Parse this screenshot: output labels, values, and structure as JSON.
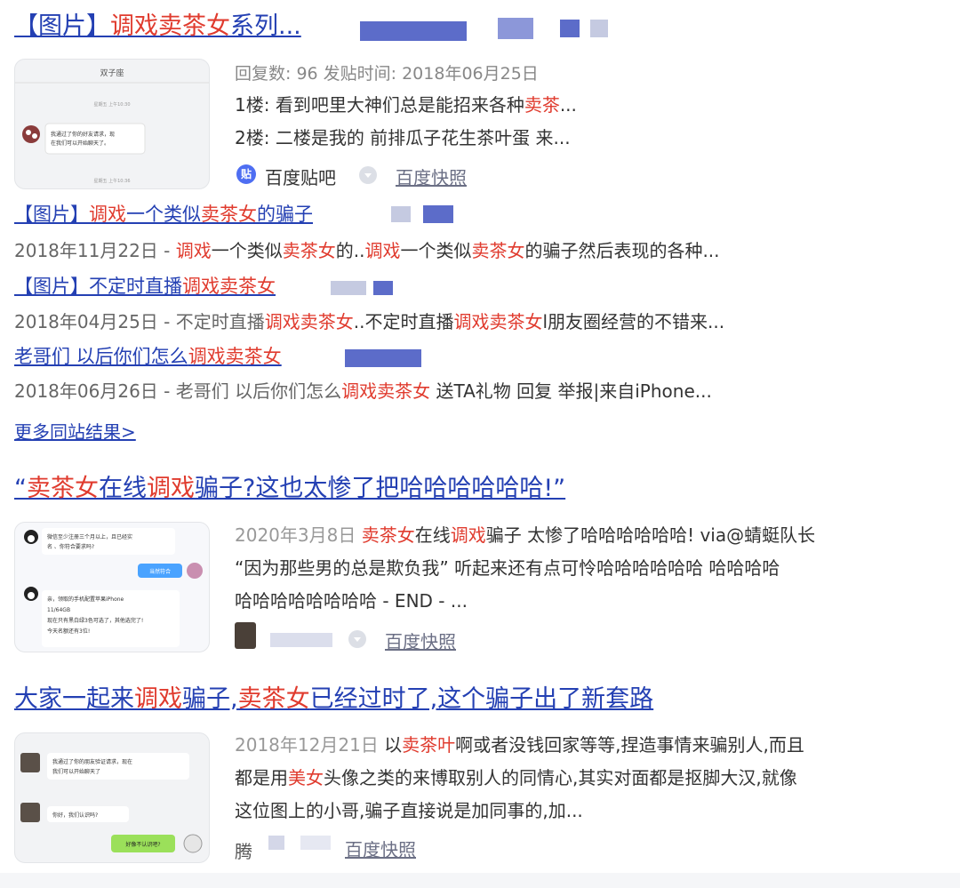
{
  "result1": {
    "title_parts": [
      "【图片】",
      "调戏卖茶女",
      "系列..."
    ],
    "thumb": {
      "header": "双子座",
      "time_top": "星期五 上午10:30",
      "bubble": "我通过了你的好友请求，现在我们可以开始聊天了。",
      "time_bottom": "星期五 上午10:36"
    },
    "meta": "回复数: 96 发贴时间: 2018年06月25日",
    "floors": [
      {
        "prefix": "1楼: 看到吧里大神们总是能招来各种",
        "hl": "卖茶",
        "suffix": "..."
      },
      {
        "prefix": "2楼: 二楼是我的 前排瓜子花生茶叶蛋 来...",
        "hl": "",
        "suffix": ""
      }
    ],
    "source_icon": "贴",
    "source": "百度贴吧",
    "snapshot": "百度快照"
  },
  "sub_results": [
    {
      "title_segments": [
        {
          "t": "【图片】",
          "red": false
        },
        {
          "t": "调戏",
          "red": true
        },
        {
          "t": "一个类似",
          "red": false
        },
        {
          "t": "卖茶女",
          "red": true
        },
        {
          "t": "的骗子",
          "red": false
        }
      ],
      "line_segments": [
        {
          "t": "2018年11月22日 - ",
          "red": false
        },
        {
          "t": "调戏",
          "red": true
        },
        {
          "t": "一个类似",
          "red": false
        },
        {
          "t": "卖茶女",
          "red": true
        },
        {
          "t": "的..",
          "red": false
        },
        {
          "t": "调戏",
          "red": true
        },
        {
          "t": "一个类似",
          "red": false
        },
        {
          "t": "卖茶女",
          "red": true
        },
        {
          "t": "的骗子然后表现的各种...",
          "red": false
        }
      ]
    },
    {
      "title_segments": [
        {
          "t": "【图片】不定时直播",
          "red": false
        },
        {
          "t": "调戏卖茶女",
          "red": true
        }
      ],
      "line_segments": [
        {
          "t": "2018年04月25日 - 不定时直播",
          "red": false
        },
        {
          "t": "调戏卖茶女",
          "red": true
        },
        {
          "t": "..不定时直播",
          "red": false
        },
        {
          "t": "调戏卖茶女",
          "red": true
        },
        {
          "t": "l朋友圈经营的不错来...",
          "red": false
        }
      ]
    },
    {
      "title_segments": [
        {
          "t": "老哥们 以后你们怎么",
          "red": false
        },
        {
          "t": "调戏卖茶女",
          "red": true
        }
      ],
      "line_segments": [
        {
          "t": "2018年06月26日 - 老哥们 以后你们怎么",
          "red": false
        },
        {
          "t": "调戏卖茶女",
          "red": true
        },
        {
          "t": " 送TA礼物 回复 举报|来自iPhone...",
          "red": false
        }
      ]
    }
  ],
  "more_link": "更多同站结果>",
  "result2": {
    "title_segments": [
      {
        "t": "“",
        "red": false
      },
      {
        "t": "卖茶女",
        "red": true
      },
      {
        "t": "在线",
        "red": false
      },
      {
        "t": "调戏",
        "red": true
      },
      {
        "t": "骗子?这也太惨了把哈哈哈哈哈哈!”",
        "red": false
      }
    ],
    "thumb": {
      "msg1": "微信至少注册三个月以上，且已经实名 、你符合要求吗?",
      "reply": "当然符合",
      "msg2_lines": [
        "亲，领取的手机配置苹果iPhone",
        "11/64GB",
        "现在只有黑白绿3色可选了，其他选完了!",
        "今天名额还有3位!"
      ]
    },
    "line1_segments": [
      {
        "t": "2020年3月8日 ",
        "red": false,
        "gray": true
      },
      {
        "t": "卖茶女",
        "red": true
      },
      {
        "t": "在线",
        "red": false
      },
      {
        "t": "调戏",
        "red": true
      },
      {
        "t": "骗子 太惨了哈哈哈哈哈哈! via@蜻蜓队长",
        "red": false
      }
    ],
    "line2": "“因为那些男的总是欺负我” 听起来还有点可怜哈哈哈哈哈哈 哈哈哈哈",
    "line3": "哈哈哈哈哈哈哈哈 - END - ...",
    "snapshot": "百度快照"
  },
  "result3": {
    "title_segments": [
      {
        "t": "大家一起来",
        "red": false
      },
      {
        "t": "调戏",
        "red": true
      },
      {
        "t": "骗子,",
        "red": false
      },
      {
        "t": "卖茶女",
        "red": true
      },
      {
        "t": "已经过时了,这个骗子出了新套路",
        "red": false
      }
    ],
    "thumb": {
      "msg1": "我通过了你的朋友验证请求，现在我们可以开始聊天了",
      "msg2": "你好，我们认识吗?",
      "reply": "好像不认识吧?"
    },
    "line1_segments": [
      {
        "t": "2018年12月21日 ",
        "red": false,
        "gray": true
      },
      {
        "t": "以",
        "red": false
      },
      {
        "t": "卖茶叶",
        "red": true
      },
      {
        "t": "啊或者没钱回家等等,捏造事情来骗别人,而且",
        "red": false
      }
    ],
    "line2_segments": [
      {
        "t": "都是用",
        "red": false
      },
      {
        "t": "美女",
        "red": true
      },
      {
        "t": "头像之类的来博取别人的同情心,其实对面都是抠脚大汉,就像",
        "red": false
      }
    ],
    "line3": "这位图上的小哥,骗子直接说是加同事的,加...",
    "source_char": "腾",
    "snapshot": "百度快照"
  },
  "colors": {
    "link": "#2440b3",
    "highlight": "#e03b2e",
    "meta": "#888888"
  }
}
